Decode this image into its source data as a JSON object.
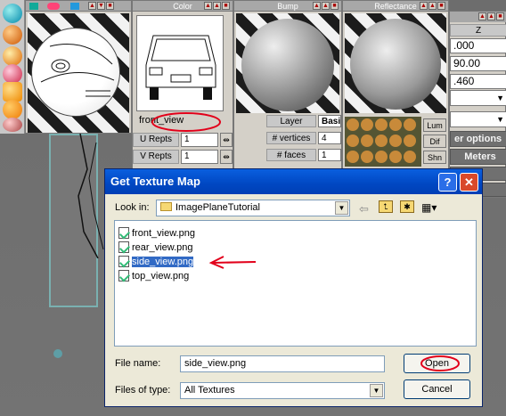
{
  "panels": {
    "color": {
      "title": "Color",
      "view_field": "front_view",
      "u_repts": {
        "label": "U Repts",
        "value": "1"
      },
      "v_repts": {
        "label": "V Repts",
        "value": "1"
      }
    },
    "bump": {
      "title": "Bump"
    },
    "reflectance": {
      "title": "Reflectance",
      "buttons": [
        "Lum",
        "Dif",
        "Shn"
      ]
    },
    "layer": {
      "layer_label": "Layer",
      "layer_value": "Basi",
      "vertices_label": "# vertices",
      "vertices_value": "4",
      "faces_label": "# faces",
      "faces_value": "1"
    },
    "coords": {
      "header": "Z",
      "values": [
        ".000",
        "90.00",
        ".460"
      ],
      "options_label": "er options",
      "meters_label": "Meters"
    }
  },
  "dialog": {
    "title": "Get Texture Map",
    "help": "?",
    "close": "✕",
    "look_in_label": "Look in:",
    "look_in_value": "ImagePlaneTutorial",
    "files": [
      "front_view.png",
      "rear_view.png",
      "side_view.png",
      "top_view.png"
    ],
    "selected_file": "side_view.png",
    "file_name_label": "File name:",
    "file_name_value": "side_view.png",
    "files_of_type_label": "Files of type:",
    "files_of_type_value": "All Textures",
    "open_label": "Open",
    "cancel_label": "Cancel"
  },
  "colors": {
    "annotation": "#e2001a",
    "titlebar": "#0054e3",
    "selection": "#316ac5"
  },
  "icons": [
    "back-arrow-icon",
    "up-folder-icon",
    "new-folder-icon",
    "view-menu-icon",
    "folder-icon",
    "file-icon"
  ]
}
